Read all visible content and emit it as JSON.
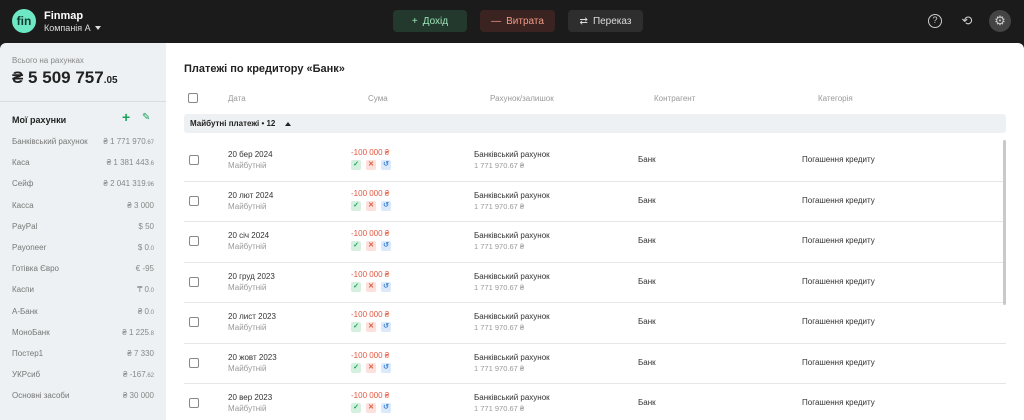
{
  "app": {
    "brand": "Finmap",
    "company": "Компанія А",
    "logo_text": "fin"
  },
  "toolbar": {
    "income_label": "Дохід",
    "expense_label": "Витрата",
    "transfer_label": "Переказ"
  },
  "sidebar": {
    "total_label": "Всього на рахунках",
    "total_main": "₴ 5 509 757",
    "total_cents": ".05",
    "accounts_title": "Мої рахунки",
    "accounts": [
      {
        "name": "Банківський рахунок",
        "amount": "₴ 1 771 970",
        "cents": ".67"
      },
      {
        "name": "Каса",
        "amount": "₴ 1 381 443",
        "cents": ".6"
      },
      {
        "name": "Сейф",
        "amount": "₴ 2 041 319",
        "cents": ".96"
      },
      {
        "name": "Касса",
        "amount": "₴ 3 000",
        "cents": ""
      },
      {
        "name": "PayPal",
        "amount": "$ 50",
        "cents": ""
      },
      {
        "name": "Payoneer",
        "amount": "$ 0",
        "cents": ".0"
      },
      {
        "name": "Готівка Євро",
        "amount": "€ -95",
        "cents": ""
      },
      {
        "name": "Каспи",
        "amount": "₸ 0",
        "cents": ".0"
      },
      {
        "name": "А-Банк",
        "amount": "₴ 0",
        "cents": ".0"
      },
      {
        "name": "МоноБанк",
        "amount": "₴ 1 225",
        "cents": ".8"
      },
      {
        "name": "Постер1",
        "amount": "₴ 7 330",
        "cents": ""
      },
      {
        "name": "УКРсиб",
        "amount": "₴ -167",
        "cents": ".62"
      },
      {
        "name": "Основні засоби",
        "amount": "₴ 30 000",
        "cents": ""
      }
    ]
  },
  "main": {
    "title": "Платежі по кредитору «Банк»",
    "columns": {
      "date": "Дата",
      "amount": "Сума",
      "account": "Рахунок/залишок",
      "counterparty": "Контрагент",
      "category": "Категорія"
    },
    "group_label": "Майбутні платежі • 12",
    "rows": [
      {
        "date": "20 бер 2024",
        "status": "Майбутній",
        "amount": "-100 000 ₴",
        "account": "Банківський рахунок",
        "balance": "1 771 970.67 ₴",
        "counterparty": "Банк",
        "category": "Погашення кредиту"
      },
      {
        "date": "20 лют 2024",
        "status": "Майбутній",
        "amount": "-100 000 ₴",
        "account": "Банківський рахунок",
        "balance": "1 771 970.67 ₴",
        "counterparty": "Банк",
        "category": "Погашення кредиту"
      },
      {
        "date": "20 січ 2024",
        "status": "Майбутній",
        "amount": "-100 000 ₴",
        "account": "Банківський рахунок",
        "balance": "1 771 970.67 ₴",
        "counterparty": "Банк",
        "category": "Погашення кредиту"
      },
      {
        "date": "20 груд 2023",
        "status": "Майбутній",
        "amount": "-100 000 ₴",
        "account": "Банківський рахунок",
        "balance": "1 771 970.67 ₴",
        "counterparty": "Банк",
        "category": "Погашення кредиту"
      },
      {
        "date": "20 лист 2023",
        "status": "Майбутній",
        "amount": "-100 000 ₴",
        "account": "Банківський рахунок",
        "balance": "1 771 970.67 ₴",
        "counterparty": "Банк",
        "category": "Погашення кредиту"
      },
      {
        "date": "20 жовт 2023",
        "status": "Майбутній",
        "amount": "-100 000 ₴",
        "account": "Банківський рахунок",
        "balance": "1 771 970.67 ₴",
        "counterparty": "Банк",
        "category": "Погашення кредиту"
      },
      {
        "date": "20 вер 2023",
        "status": "Майбутній",
        "amount": "-100 000 ₴",
        "account": "Банківський рахунок",
        "balance": "1 771 970.67 ₴",
        "counterparty": "Банк",
        "category": "Погашення кредиту"
      }
    ]
  },
  "icons": {
    "help": "help-icon",
    "history": "history-icon",
    "settings": "gear-icon",
    "confirm": "check-icon",
    "delete": "close-icon",
    "undo": "undo-icon"
  },
  "colors": {
    "accent": "#6ee7c5",
    "income": "#9fe6b9",
    "expense": "#e2573f",
    "brand_green": "#1aa35b"
  }
}
